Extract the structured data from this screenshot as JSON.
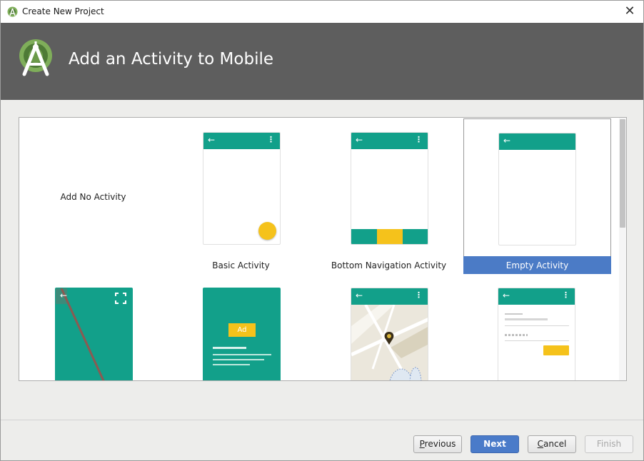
{
  "window": {
    "title": "Create New Project",
    "close_glyph": "✕"
  },
  "header": {
    "title": "Add an Activity to Mobile",
    "logo_icon": "android-studio-logo"
  },
  "gallery": {
    "items": [
      {
        "label": "Add No Activity",
        "selected": false
      },
      {
        "label": "Basic Activity",
        "selected": false
      },
      {
        "label": "Bottom Navigation Activity",
        "selected": false
      },
      {
        "label": "Empty Activity",
        "selected": true
      },
      {
        "label": "",
        "selected": false
      },
      {
        "label": "",
        "selected": false
      },
      {
        "label": "",
        "selected": false
      },
      {
        "label": "",
        "selected": false
      }
    ],
    "ad_label": "Ad"
  },
  "buttons": {
    "previous": {
      "mnemonic": "P",
      "rest": "revious"
    },
    "next": "Next",
    "cancel": {
      "mnemonic": "C",
      "rest": "ancel"
    },
    "finish": "Finish"
  },
  "colors": {
    "teal": "#12a08a",
    "accent_yellow": "#f5c21b",
    "selection_blue": "#4b7bc6",
    "header_gray": "#5e5e5e"
  }
}
